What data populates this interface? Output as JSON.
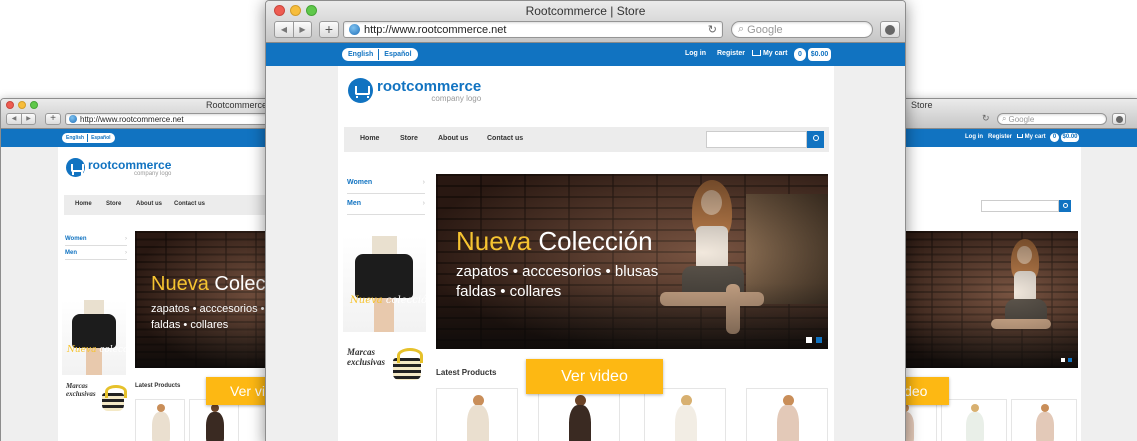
{
  "browser": {
    "title": "Rootcommerce | Store",
    "title_right": "Store",
    "url": "http://www.rootcommerce.net",
    "search_placeholder": "Google",
    "back": "◀",
    "forward": "▶",
    "new_tab": "+",
    "reload": "↻"
  },
  "store": {
    "languages": [
      "English",
      "Español"
    ],
    "top_links": {
      "login": "Log in",
      "register": "Register",
      "cart": "My cart",
      "cart_count": "0",
      "cart_total": "$0.00"
    },
    "logo": {
      "name": "rootcommerce",
      "tagline": "company logo"
    },
    "menu": [
      "Home",
      "Store",
      "About us",
      "Contact us"
    ],
    "categories": [
      "Women",
      "Men"
    ],
    "promo": {
      "word1": "Nueva",
      "word2": "colección"
    },
    "marcas": {
      "line1": "Marcas",
      "line2": "exclusivas"
    },
    "hero": {
      "word1": "Nueva",
      "word2": "Colección",
      "line1": "zapatos • acccesorios • blusas",
      "line2": "faldas •  collares"
    },
    "latest_products": "Latest Products",
    "video_button": "Ver video",
    "video_button_right": "ideo"
  },
  "colors": {
    "brand_blue": "#1173c1",
    "accent_yellow": "#fdb813",
    "title_yellow": "#f6c431"
  }
}
